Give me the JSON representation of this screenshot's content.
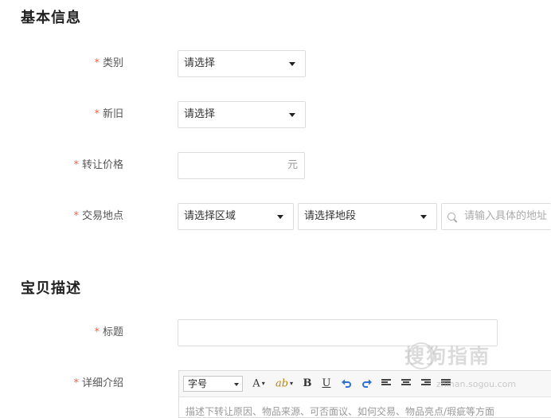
{
  "sections": {
    "basic_info": "基本信息",
    "description": "宝贝描述"
  },
  "required_mark": "*",
  "fields": {
    "category": {
      "label": "类别",
      "value": "请选择"
    },
    "condition": {
      "label": "新旧",
      "value": "请选择"
    },
    "price": {
      "label": "转让价格",
      "unit": "元",
      "value": ""
    },
    "location": {
      "label": "交易地点",
      "area": "请选择区域",
      "segment": "请选择地段",
      "address_placeholder": "请输入具体的地址"
    },
    "title": {
      "label": "标题",
      "value": ""
    },
    "detail": {
      "label": "详细介绍",
      "placeholder": "描述下转让原因、物品来源、可否面议、如何交易、物品亮点/瑕疵等方面"
    }
  },
  "editor_toolbar": {
    "font_size": "字号",
    "font_color": "A",
    "highlight": "ab",
    "bold": "B",
    "underline": "U",
    "undo_icon": "undo-icon",
    "redo_icon": "redo-icon",
    "align_left_icon": "align-left-icon",
    "align_center_icon": "align-center-icon",
    "align_right_icon": "align-right-icon",
    "justify_icon": "justify-icon"
  },
  "watermark": {
    "brand": "搜狗指南",
    "url": "zhinan.sogou.com"
  },
  "colors": {
    "required": "#ff5a3c",
    "undo": "#2f6fd6"
  }
}
